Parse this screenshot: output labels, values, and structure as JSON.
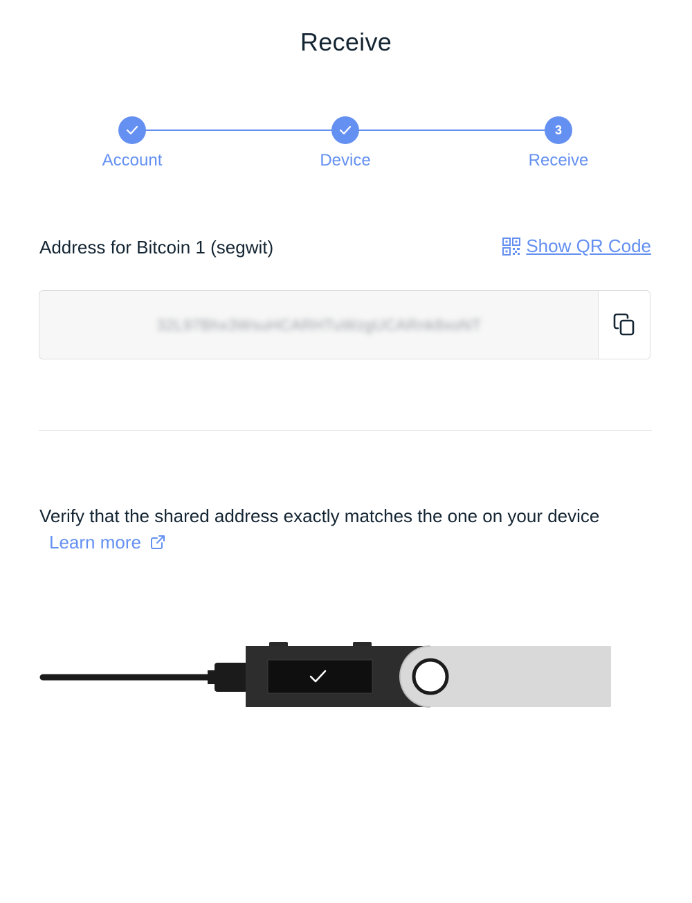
{
  "header": {
    "title": "Receive"
  },
  "stepper": {
    "steps": [
      {
        "label": "Account",
        "state": "done"
      },
      {
        "label": "Device",
        "state": "done"
      },
      {
        "label": "Receive",
        "state": "current",
        "number": "3"
      }
    ],
    "accent_color": "#6490f1"
  },
  "address": {
    "label": "Address for Bitcoin 1 (segwit)",
    "show_qr_label": "Show QR Code",
    "value": "32L97Bhx3WsuHCARHTuWzgUCARnk8xoNT",
    "copy_icon": "copy-icon",
    "qr_icon": "qr-code-icon"
  },
  "verify": {
    "text": "Verify that the shared address exactly matches the one on your device",
    "learn_more_label": "Learn more",
    "external_icon": "external-link-icon"
  },
  "device_illustration": {
    "icon": "ledger-device-icon",
    "screen_icon": "check-icon"
  }
}
